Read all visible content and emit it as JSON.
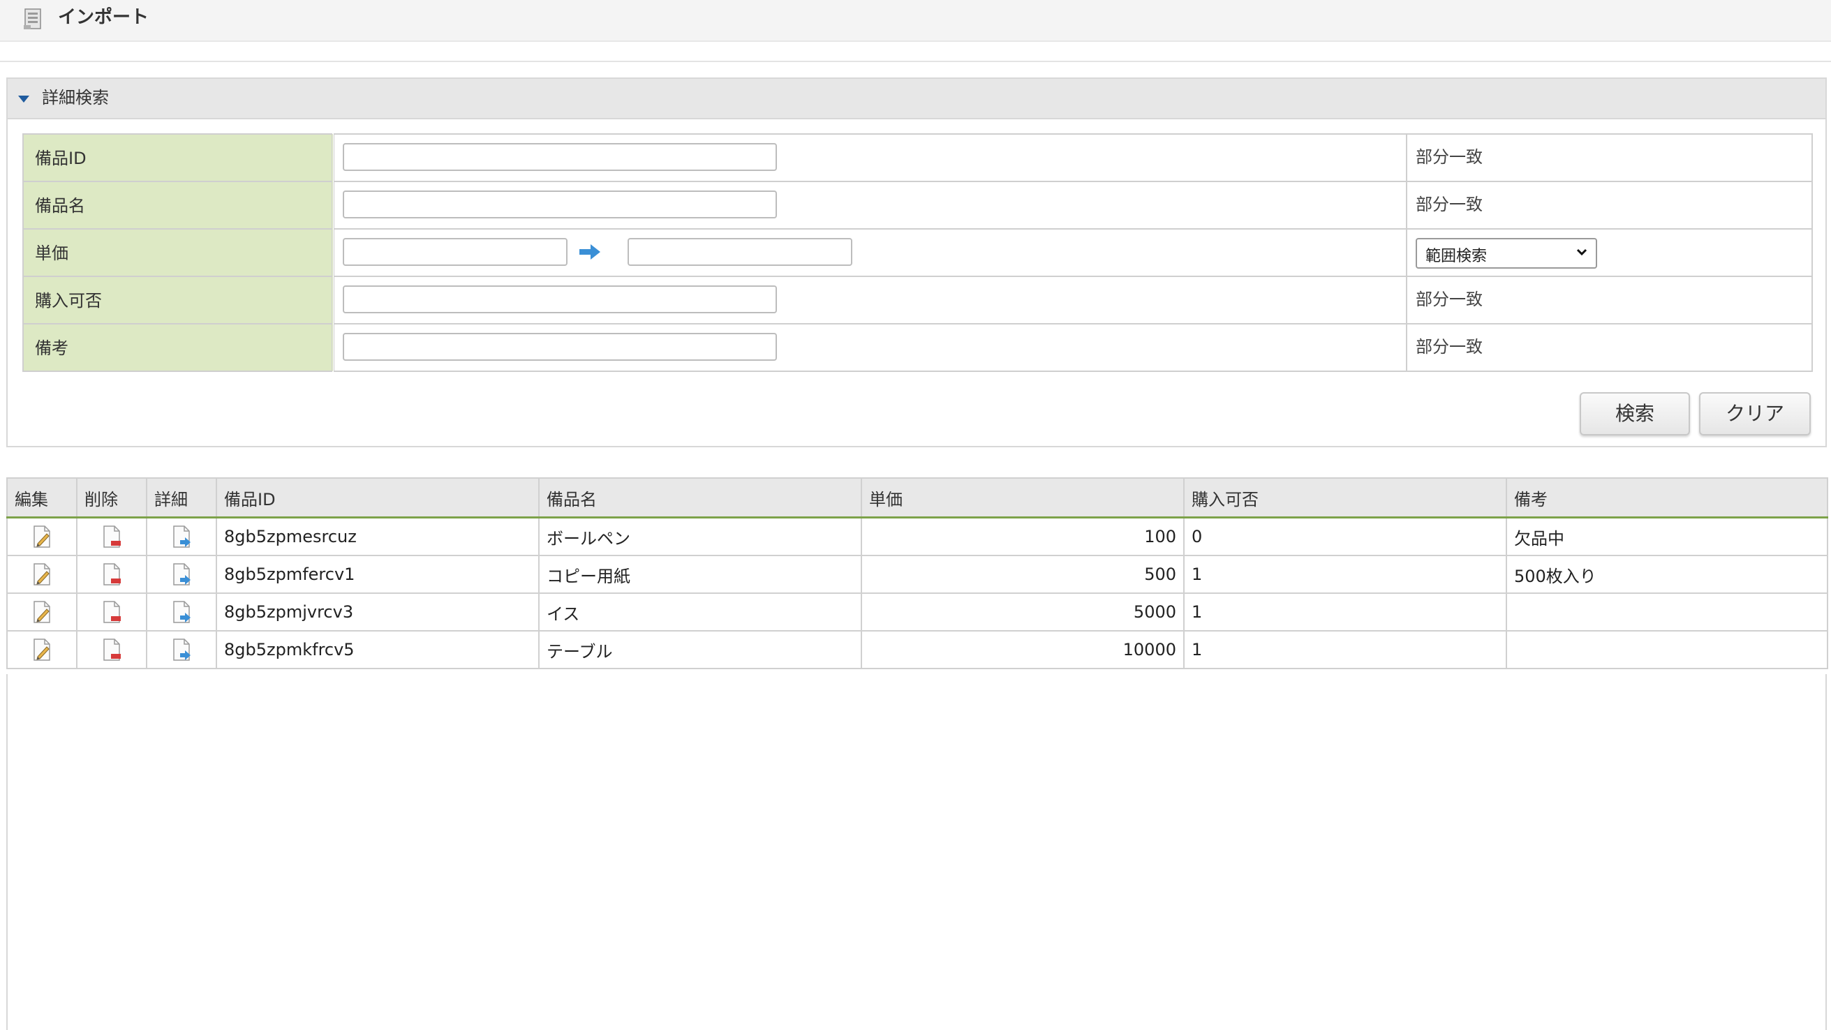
{
  "header": {
    "title": "インポート",
    "icon": "import-icon"
  },
  "search_panel": {
    "title": "詳細検索",
    "fields": [
      {
        "label": "備品ID",
        "value": "",
        "match": "部分一致"
      },
      {
        "label": "備品名",
        "value": "",
        "match": "部分一致"
      },
      {
        "label": "単価",
        "from": "",
        "to": "",
        "match_select": "範囲検索"
      },
      {
        "label": "購入可否",
        "value": "",
        "match": "部分一致"
      },
      {
        "label": "備考",
        "value": "",
        "match": "部分一致"
      }
    ],
    "search_button": "検索",
    "clear_button": "クリア"
  },
  "table": {
    "columns": [
      "編集",
      "削除",
      "詳細",
      "備品ID",
      "備品名",
      "単価",
      "購入可否",
      "備考"
    ],
    "rows": [
      {
        "id": "8gb5zpmesrcuz",
        "name": "ボールペン",
        "price": "100",
        "purchasable": "0",
        "note": "欠品中"
      },
      {
        "id": "8gb5zpmfercv1",
        "name": "コピー用紙",
        "price": "500",
        "purchasable": "1",
        "note": "500枚入り"
      },
      {
        "id": "8gb5zpmjvrcv3",
        "name": "イス",
        "price": "5000",
        "purchasable": "1",
        "note": ""
      },
      {
        "id": "8gb5zpmkfrcv5",
        "name": "テーブル",
        "price": "10000",
        "purchasable": "1",
        "note": ""
      }
    ],
    "row_icons": [
      "edit-icon",
      "delete-icon",
      "detail-icon"
    ]
  },
  "colors": {
    "label_bg": "#dde9c4",
    "header_accent": "#7da24a",
    "arrow": "#3a8fd6"
  }
}
